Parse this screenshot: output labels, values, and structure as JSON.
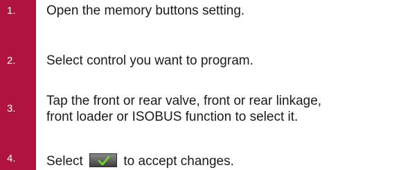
{
  "steps": [
    {
      "number": "1.",
      "text": "Open the memory buttons setting."
    },
    {
      "number": "2.",
      "text": "Select control you want to program."
    },
    {
      "number": "3.",
      "text_line1": "Tap the front or rear valve, front or rear linkage,",
      "text_line2": "front loader or ISOBUS function to select it."
    },
    {
      "number": "4.",
      "text_before": "Select",
      "icon": "accept-checkmark-icon",
      "text_after": "to accept changes."
    }
  ],
  "colors": {
    "number_box": "#b0133d",
    "number_text": "#ffffff",
    "body_text": "#1a1a1a",
    "checkmark": "#6fcf2f"
  }
}
